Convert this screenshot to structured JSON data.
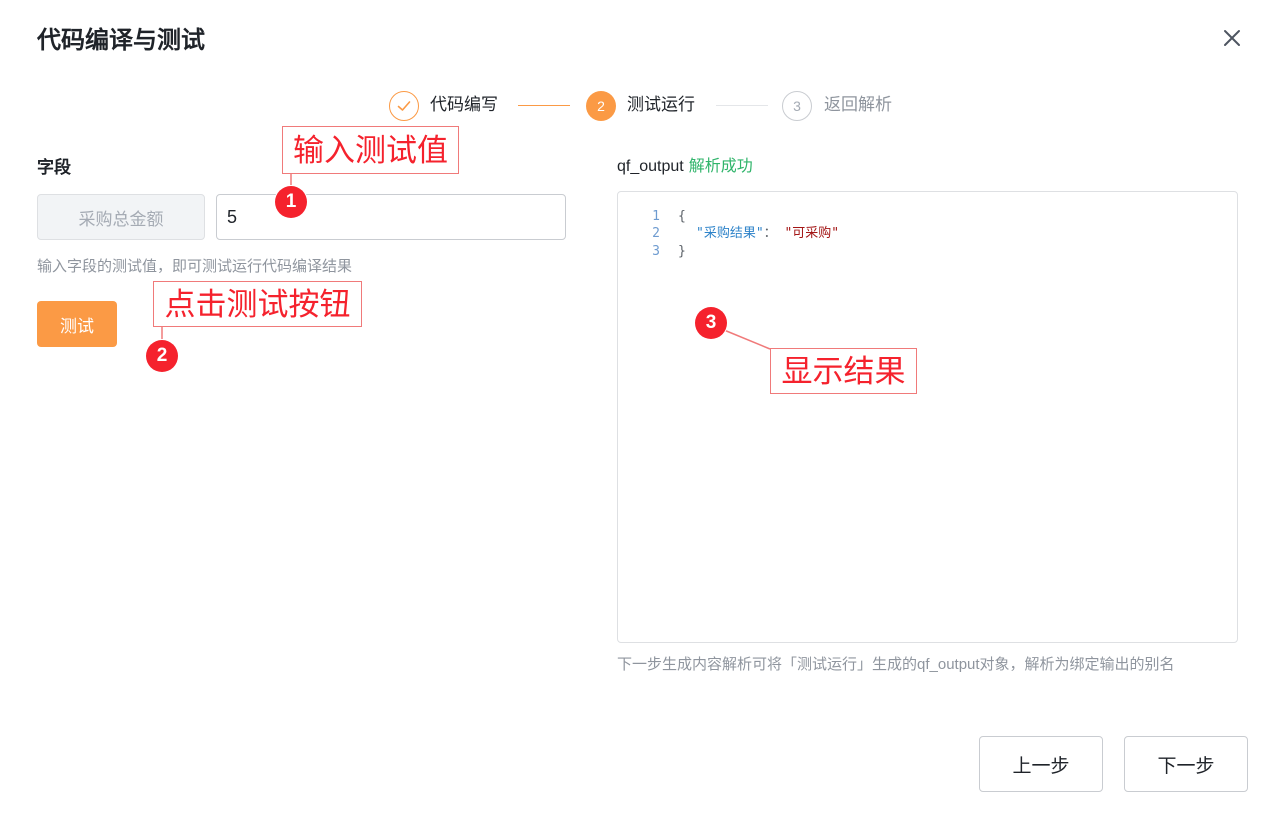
{
  "dialog": {
    "title": "代码编译与测试"
  },
  "steps": [
    {
      "number": "",
      "label": "代码编写",
      "state": "done"
    },
    {
      "number": "2",
      "label": "测试运行",
      "state": "active"
    },
    {
      "number": "3",
      "label": "返回解析",
      "state": "pending"
    }
  ],
  "field_section": {
    "label": "字段",
    "field_name": "采购总金额",
    "test_value": "5",
    "help": "输入字段的测试值，即可测试运行代码编译结果",
    "test_button": "测试"
  },
  "output_section": {
    "var_name": "qf_output",
    "status": "解析成功",
    "code_lines": [
      {
        "no": "1",
        "text": "{"
      },
      {
        "no": "2",
        "key": "\"采购结果\"",
        "sep": "： ",
        "value": "\"可采购\""
      },
      {
        "no": "3",
        "text": "}"
      }
    ],
    "footnote": "下一步生成内容解析可将「测试运行」生成的qf_output对象，解析为绑定输出的别名"
  },
  "footer": {
    "prev": "上一步",
    "next": "下一步"
  },
  "annotations": [
    {
      "number": "1",
      "text": "输入测试值"
    },
    {
      "number": "2",
      "text": "点击测试按钮"
    },
    {
      "number": "3",
      "text": "显示结果"
    }
  ],
  "colors": {
    "accent": "#fb9a45",
    "success": "#2fb46a",
    "annotation": "#f5222d"
  }
}
